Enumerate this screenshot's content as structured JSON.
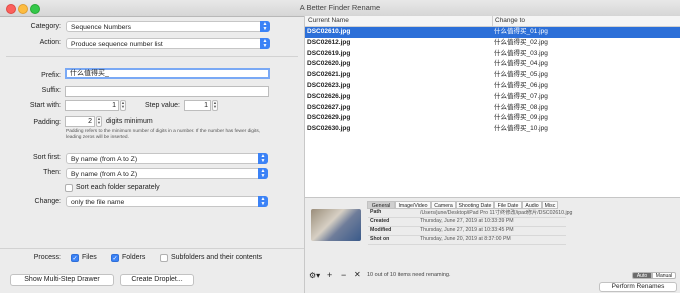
{
  "window": {
    "title": "A Better Finder Rename"
  },
  "rename": {
    "category_label": "Category:",
    "category_value": "Sequence Numbers",
    "action_label": "Action:",
    "action_value": "Produce sequence number list",
    "prefix_label": "Prefix:",
    "prefix_value": "什么值得买_",
    "suffix_label": "Suffix:",
    "suffix_value": "",
    "start_label": "Start with:",
    "start_value": "1",
    "step_label": "Step value:",
    "step_value": "1",
    "padding_label": "Padding:",
    "padding_value": "2",
    "padding_unit": "digits minimum",
    "padding_note": "Padding refers to the minimum number of digits in a number. If the number has fewer digits, leading zeros will be inserted."
  },
  "sort": {
    "first_label": "Sort first:",
    "first_value": "By name (from A to Z)",
    "then_label": "Then:",
    "then_value": "By name (from A to Z)",
    "each_folder_label": "Sort each folder separately",
    "each_folder_checked": false,
    "change_label": "Change:",
    "change_value": "only the file name"
  },
  "process": {
    "label": "Process:",
    "files_label": "Files",
    "files_checked": true,
    "folders_label": "Folders",
    "folders_checked": true,
    "subfolders_label": "Subfolders and their contents",
    "subfolders_checked": false
  },
  "buttons": {
    "multi_step": "Show Multi-Step Drawer",
    "droplet": "Create Droplet...",
    "perform": "Perform Renames"
  },
  "table": {
    "col_current": "Current Name",
    "col_change": "Change to",
    "rows": [
      {
        "current": "DSC02610.jpg",
        "change": "什么值得买_01.jpg"
      },
      {
        "current": "DSC02612.jpg",
        "change": "什么值得买_02.jpg"
      },
      {
        "current": "DSC02619.jpg",
        "change": "什么值得买_03.jpg"
      },
      {
        "current": "DSC02620.jpg",
        "change": "什么值得买_04.jpg"
      },
      {
        "current": "DSC02621.jpg",
        "change": "什么值得买_05.jpg"
      },
      {
        "current": "DSC02623.jpg",
        "change": "什么值得买_06.jpg"
      },
      {
        "current": "DSC02626.jpg",
        "change": "什么值得买_07.jpg"
      },
      {
        "current": "DSC02627.jpg",
        "change": "什么值得买_08.jpg"
      },
      {
        "current": "DSC02629.jpg",
        "change": "什么值得买_09.jpg"
      },
      {
        "current": "DSC02630.jpg",
        "change": "什么值得买_10.jpg"
      }
    ]
  },
  "info": {
    "tabs": [
      "General",
      "Image/Video",
      "Camera",
      "Shooting Date",
      "File Date",
      "Audio",
      "Misc"
    ],
    "path_label": "Path",
    "path_value": "/Users/june/Desktop/iPad Pro 11寸终修改/ipad修片/DSC02610.jpg",
    "created_label": "Created",
    "created_value": "Thursday, June 27, 2019 at 10:33:39 PM",
    "modified_label": "Modified",
    "modified_value": "Thursday, June 27, 2019 at 10:33:45 PM",
    "shot_label": "Shot on",
    "shot_value": "Thursday, June 20, 2019 at 8:37:00 PM"
  },
  "status": {
    "text": "10 out of 10 items need renaming.",
    "auto": "Auto",
    "manual": "Manual"
  },
  "icons": [
    "gear-icon",
    "plus-icon",
    "minus-icon",
    "close-icon",
    "chevron-updown-icon",
    "checkmark-icon"
  ],
  "colors": {
    "accent": "#3b82f6",
    "selection": "#2c6fd8"
  }
}
